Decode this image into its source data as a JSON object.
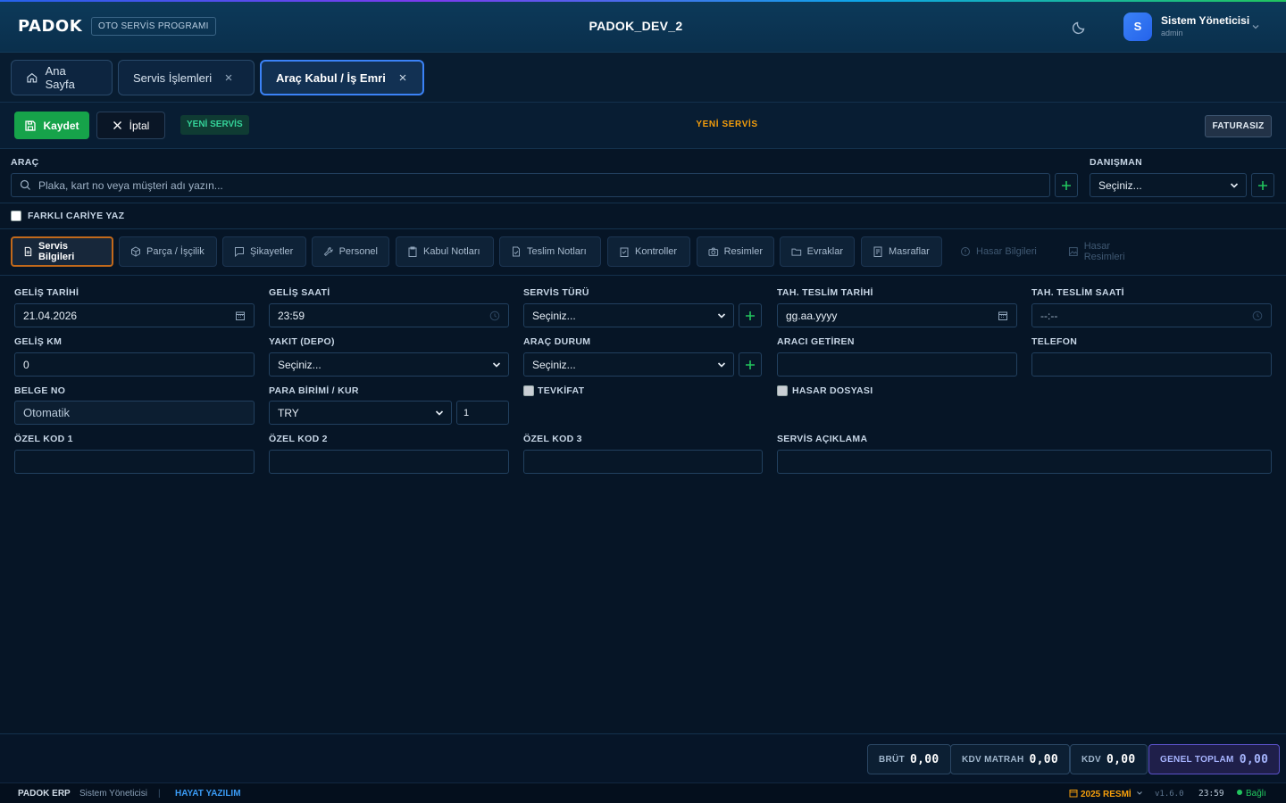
{
  "app": {
    "logo": "PADOK",
    "tagline": "OTO SERVİS PROGRAMI",
    "database": "PADOK_DEV_2"
  },
  "user": {
    "initial": "S",
    "name": "Sistem Yöneticisi",
    "role": "admin"
  },
  "tabs": [
    {
      "label": "Ana Sayfa",
      "icon": "home-icon"
    },
    {
      "label": "Servis İşlemleri",
      "icon": "close-icon"
    },
    {
      "label": "Araç Kabul / İş Emri",
      "icon": "close-icon",
      "active": true
    }
  ],
  "toolbar": {
    "save_label": "Kaydet",
    "cancel_label": "İptal",
    "badge": "YENİ SERVİS",
    "status": "YENİ SERVİS",
    "invoice_label": "FATURASIZ"
  },
  "vehicle": {
    "label": "ARAÇ",
    "placeholder": "Plaka, kart no veya müşteri adı yazın...",
    "advisor_label": "DANIŞMAN",
    "advisor_value": "Seçiniz...",
    "different_account_label": "FARKLI CARİYE YAZ"
  },
  "subtabs": [
    {
      "label": "Servis Bilgileri",
      "icon": "document-icon",
      "active": true
    },
    {
      "label": "Parça / İşçilik",
      "icon": "box-icon"
    },
    {
      "label": "Şikayetler",
      "icon": "message-icon"
    },
    {
      "label": "Personel",
      "icon": "wrench-icon"
    },
    {
      "label": "Kabul Notları",
      "icon": "clipboard-icon"
    },
    {
      "label": "Teslim Notları",
      "icon": "file-icon"
    },
    {
      "label": "Kontroller",
      "icon": "checklist-icon"
    },
    {
      "label": "Resimler",
      "icon": "camera-icon"
    },
    {
      "label": "Evraklar",
      "icon": "folder-icon"
    },
    {
      "label": "Masraflar",
      "icon": "receipt-icon"
    },
    {
      "label": "Hasar Bilgileri",
      "icon": "shield-icon",
      "disabled": true
    },
    {
      "label": "Hasar Resimleri",
      "icon": "image-icon",
      "disabled": true
    }
  ],
  "form": {
    "arrival_date": {
      "label": "GELİŞ TARİHİ",
      "value": "21.04.2026"
    },
    "arrival_time": {
      "label": "GELİŞ SAATİ",
      "value": "23:59"
    },
    "service_type": {
      "label": "SERVİS TÜRÜ",
      "value": "Seçiniz..."
    },
    "est_delivery_date": {
      "label": "TAH. TESLİM TARİHİ",
      "value": "gg.aa.yyyy"
    },
    "est_delivery_time": {
      "label": "TAH. TESLİM SAATİ",
      "value": "--:--"
    },
    "arrival_km": {
      "label": "GELİŞ KM",
      "value": "0"
    },
    "fuel": {
      "label": "YAKIT (DEPO)",
      "value": "Seçiniz..."
    },
    "vehicle_status": {
      "label": "ARAÇ DURUM",
      "value": "Seçiniz..."
    },
    "brought_by": {
      "label": "ARACI GETİREN",
      "value": ""
    },
    "phone": {
      "label": "TELEFON",
      "value": ""
    },
    "doc_no": {
      "label": "BELGE NO",
      "value": "Otomatik"
    },
    "currency": {
      "label": "PARA BİRİMİ / KUR",
      "value": "TRY",
      "rate": "1"
    },
    "withholding": {
      "label": "TEVKİFAT"
    },
    "damage_file": {
      "label": "HASAR DOSYASI"
    },
    "code1": {
      "label": "ÖZEL KOD 1",
      "value": ""
    },
    "code2": {
      "label": "ÖZEL KOD 2",
      "value": ""
    },
    "code3": {
      "label": "ÖZEL KOD 3",
      "value": ""
    },
    "service_note": {
      "label": "SERVİS AÇIKLAMA",
      "value": ""
    }
  },
  "totals": [
    {
      "label": "BRÜT",
      "value": "0,00"
    },
    {
      "label": "KDV MATRAH",
      "value": "0,00"
    },
    {
      "label": "KDV",
      "value": "0,00"
    },
    {
      "label": "GENEL TOPLAM",
      "value": "0,00"
    }
  ],
  "statusbar": {
    "product": "PADOK ERP",
    "user": "Sistem Yöneticisi",
    "company": "HAYAT YAZILIM",
    "fiscal_year": "2025 RESMİ",
    "version": "v1.6.0",
    "time": "23:59",
    "connection": "Bağlı"
  },
  "colors": {
    "accent": "#3b82f6",
    "save": "#16a34a",
    "status": "#f59e0b",
    "active_subtab_border": "#c2691b",
    "plus": "#22c55e"
  }
}
